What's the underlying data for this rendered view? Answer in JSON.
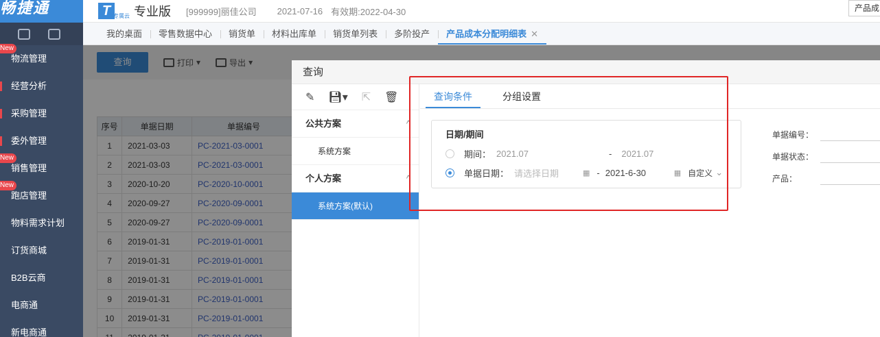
{
  "app": {
    "logo_text": "畅捷通",
    "brand_mark": "T",
    "brand_sub": "专属云",
    "edition": "专业版",
    "company": "[999999]丽佳公司",
    "date": "2021-07-16",
    "validity": "有效期:2022-04-30",
    "header_right": "产品成"
  },
  "sidebar": {
    "items": [
      {
        "label": "物流管理",
        "badge": "New",
        "bar": false
      },
      {
        "label": "经营分析",
        "badge": "",
        "bar": true
      },
      {
        "label": "采购管理",
        "badge": "",
        "bar": true
      },
      {
        "label": "委外管理",
        "badge": "",
        "bar": true
      },
      {
        "label": "销售管理",
        "badge": "New",
        "bar": false
      },
      {
        "label": "跑店管理",
        "badge": "New",
        "bar": false
      },
      {
        "label": "物料需求计划",
        "badge": "",
        "bar": false
      },
      {
        "label": "订货商城",
        "badge": "",
        "bar": false
      },
      {
        "label": "B2B云商",
        "badge": "",
        "bar": false
      },
      {
        "label": "电商通",
        "badge": "",
        "bar": false
      },
      {
        "label": "新电商通",
        "badge": "",
        "bar": false
      }
    ]
  },
  "tabs": [
    {
      "label": "我的桌面",
      "active": false
    },
    {
      "label": "零售数据中心",
      "active": false
    },
    {
      "label": "销货单",
      "active": false
    },
    {
      "label": "材料出库单",
      "active": false
    },
    {
      "label": "销货单列表",
      "active": false
    },
    {
      "label": "多阶投产",
      "active": false
    },
    {
      "label": "产品成本分配明细表",
      "active": true
    }
  ],
  "toolbar": {
    "query": "查询",
    "print": "打印",
    "export": "导出"
  },
  "grid": {
    "headers": [
      "序号",
      "单据日期",
      "单据编号"
    ],
    "rows": [
      [
        "1",
        "2021-03-03",
        "PC-2021-03-0001"
      ],
      [
        "2",
        "2021-03-03",
        "PC-2021-03-0001"
      ],
      [
        "3",
        "2020-10-20",
        "PC-2020-10-0001"
      ],
      [
        "4",
        "2020-09-27",
        "PC-2020-09-0001"
      ],
      [
        "5",
        "2020-09-27",
        "PC-2020-09-0001"
      ],
      [
        "6",
        "2019-01-31",
        "PC-2019-01-0001"
      ],
      [
        "7",
        "2019-01-31",
        "PC-2019-01-0001"
      ],
      [
        "8",
        "2019-01-31",
        "PC-2019-01-0001"
      ],
      [
        "9",
        "2019-01-31",
        "PC-2019-01-0001"
      ],
      [
        "10",
        "2019-01-31",
        "PC-2019-01-0001"
      ],
      [
        "11",
        "2019-01-31",
        "PC-2019-01-0001"
      ]
    ]
  },
  "dialog": {
    "title": "查询",
    "public_group": "公共方案",
    "public_item": "系统方案",
    "personal_group": "个人方案",
    "personal_item": "系统方案(默认)",
    "tab_conditions": "查询条件",
    "tab_grouping": "分组设置",
    "date_box_title": "日期/期间",
    "period_label": "期间：",
    "period_from": "2021.07",
    "period_sep": "-",
    "period_to": "2021.07",
    "docdate_label": "单据日期：",
    "docdate_placeholder": "请选择日期",
    "docdate_sep": "-",
    "docdate_to": "2021-6-30",
    "range_select": "自定义",
    "field_docno": "单据编号：",
    "field_status": "单据状态：",
    "field_product": "产品："
  }
}
